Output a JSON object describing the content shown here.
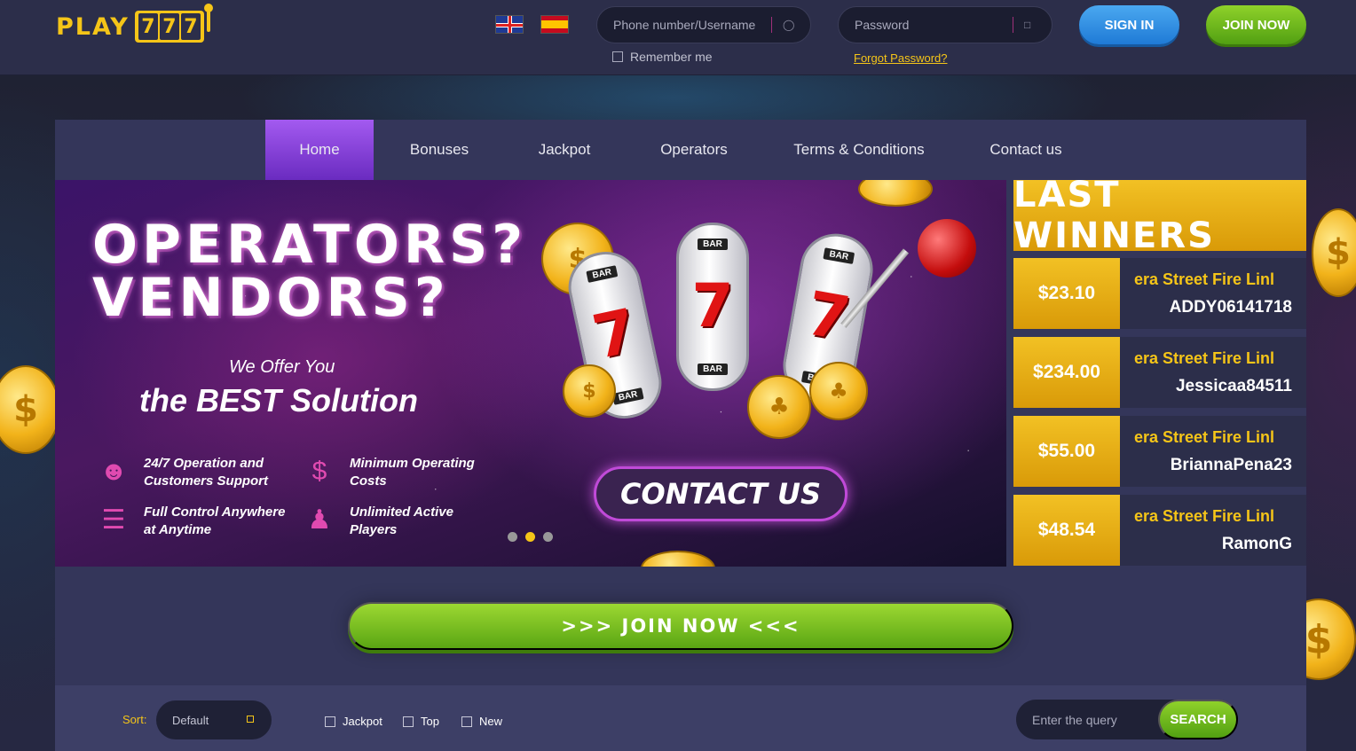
{
  "logo": {
    "text": "PLAY",
    "reels": [
      "7",
      "7",
      "7"
    ]
  },
  "header": {
    "languages": [
      {
        "name": "English",
        "icon": "uk-flag-icon"
      },
      {
        "name": "Spanish",
        "icon": "spain-flag-icon"
      }
    ],
    "username_placeholder": "Phone number/Username",
    "password_placeholder": "Password",
    "remember_label": "Remember me",
    "forgot_label": "Forgot Password?",
    "signin_label": "SIGN IN",
    "join_label": "JOIN NOW"
  },
  "nav": {
    "items": [
      {
        "label": "Home",
        "active": true
      },
      {
        "label": "Bonuses"
      },
      {
        "label": "Jackpot"
      },
      {
        "label": "Operators"
      },
      {
        "label": "Terms & Conditions"
      },
      {
        "label": "Contact us"
      }
    ]
  },
  "banner": {
    "headline_1": "OPERATORS?",
    "headline_2": "VENDORS?",
    "offer": "We Offer You",
    "best": "the BEST Solution",
    "features": [
      {
        "text": "24/7 Operation and Customers Support",
        "icon": "headset-icon"
      },
      {
        "text": "Minimum Operating Costs",
        "icon": "money-bag-icon"
      },
      {
        "text": "Full Control Anywhere at Anytime",
        "icon": "sliders-icon"
      },
      {
        "text": "Unlimited Active Players",
        "icon": "users-icon"
      }
    ],
    "contact_label": "CONTACT US",
    "slide_count": 3,
    "active_slide": 2,
    "reel_symbol": "7",
    "reel_bar": "BAR"
  },
  "winners": {
    "title": "LAST WINNERS",
    "items": [
      {
        "amount": "$23.10",
        "game": "era Street    Fire Linl",
        "user": "ADDY06141718"
      },
      {
        "amount": "$234.00",
        "game": "era Street    Fire Linl",
        "user": "Jessicaa84511"
      },
      {
        "amount": "$55.00",
        "game": "era Street    Fire Linl",
        "user": "BriannaPena23"
      },
      {
        "amount": "$48.54",
        "game": "era Street    Fire Linl",
        "user": "RamonG"
      }
    ]
  },
  "join_bar": {
    "label": ">>>  JOIN NOW  <<<"
  },
  "filters": {
    "sort_label": "Sort:",
    "sort_value": "Default",
    "checkboxes": [
      "Jackpot",
      "Top",
      "New"
    ],
    "search_placeholder": "Enter the query",
    "search_label": "SEARCH"
  },
  "colors": {
    "accent_gold": "#f5c518",
    "accent_purple": "#a35af0",
    "accent_green": "#8fd12a",
    "accent_blue": "#1f7ad6",
    "background": "#262842",
    "panel": "#34365a"
  }
}
